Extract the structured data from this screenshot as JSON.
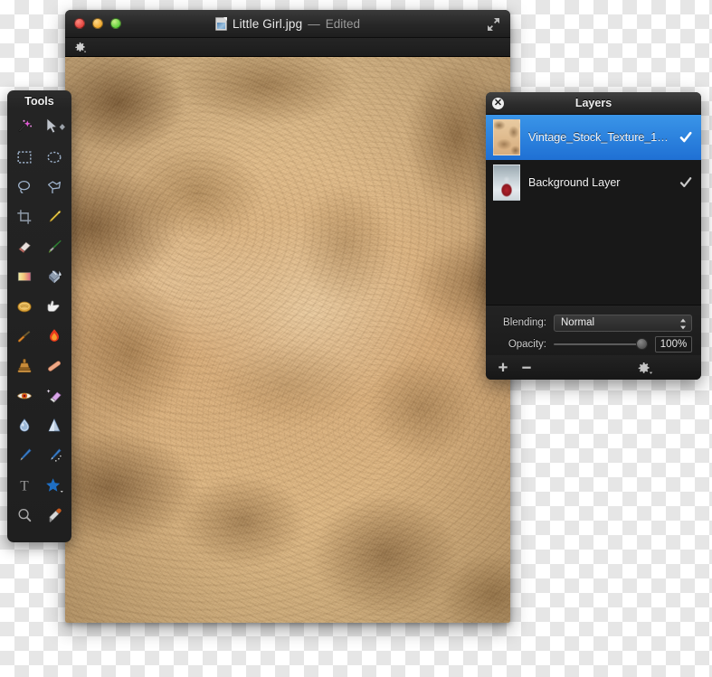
{
  "window": {
    "title_filename": "Little Girl.jpg",
    "title_separator": "—",
    "title_status": "Edited",
    "traffic_lights": [
      "close",
      "minimize",
      "zoom"
    ],
    "fullscreen_icon": "fullscreen-arrows-icon",
    "doc_icon": "jpeg-document-icon",
    "toolstrip_gear_icon": "gear-dropdown-icon"
  },
  "tools": {
    "title": "Tools",
    "items": [
      {
        "name": "magic-wand-tool",
        "icon": "magic-wand-icon"
      },
      {
        "name": "move-tool",
        "icon": "arrow-move-icon"
      },
      {
        "name": "rectangular-select-tool",
        "icon": "rectangle-marquee-icon"
      },
      {
        "name": "elliptical-select-tool",
        "icon": "ellipse-marquee-icon"
      },
      {
        "name": "lasso-tool",
        "icon": "lasso-icon"
      },
      {
        "name": "polygon-lasso-tool",
        "icon": "polygon-lasso-icon"
      },
      {
        "name": "crop-tool",
        "icon": "crop-icon"
      },
      {
        "name": "pencil-tool",
        "icon": "pencil-icon"
      },
      {
        "name": "eraser-tool",
        "icon": "eraser-icon"
      },
      {
        "name": "paintbrush-tool",
        "icon": "paintbrush-icon"
      },
      {
        "name": "gradient-tool",
        "icon": "gradient-icon"
      },
      {
        "name": "paint-bucket-tool",
        "icon": "paint-bucket-icon"
      },
      {
        "name": "clone-tool",
        "icon": "stamp-disc-icon"
      },
      {
        "name": "smudge-tool",
        "icon": "smudge-hand-icon"
      },
      {
        "name": "blur-brush-tool",
        "icon": "wide-brush-icon"
      },
      {
        "name": "burn-tool",
        "icon": "flame-icon"
      },
      {
        "name": "rubber-stamp-tool",
        "icon": "rubber-stamp-icon"
      },
      {
        "name": "bandage-tool",
        "icon": "bandage-icon"
      },
      {
        "name": "red-eye-tool",
        "icon": "eye-icon"
      },
      {
        "name": "background-eraser-tool",
        "icon": "magic-eraser-icon"
      },
      {
        "name": "water-drop-tool",
        "icon": "water-drop-icon"
      },
      {
        "name": "sharpen-cone-tool",
        "icon": "cone-icon"
      },
      {
        "name": "draw-pen-tool",
        "icon": "blue-pencil-icon"
      },
      {
        "name": "vector-pen-tool",
        "icon": "vector-pen-icon"
      },
      {
        "name": "text-tool",
        "icon": "text-t-icon"
      },
      {
        "name": "shape-tool",
        "icon": "star-shape-icon"
      },
      {
        "name": "zoom-tool",
        "icon": "magnifier-icon"
      },
      {
        "name": "eyedropper-tool",
        "icon": "eyedropper-icon"
      }
    ]
  },
  "layers_panel": {
    "title": "Layers",
    "close_icon": "close-x-icon",
    "layers": [
      {
        "name": "Vintage_Stock_Texture_1_b...",
        "visible_checked": true,
        "selected": true,
        "thumbnail": "vintage-paper-texture-thumbnail"
      },
      {
        "name": "Background Layer",
        "visible_checked": true,
        "selected": false,
        "thumbnail": "snowy-photo-thumbnail"
      }
    ],
    "blending": {
      "label": "Blending:",
      "value": "Normal",
      "stepper_icon": "stepper-up-down-icon"
    },
    "opacity": {
      "label": "Opacity:",
      "value": "100%",
      "slider_percent": 100
    },
    "footer": {
      "add_icon": "plus-icon",
      "remove_icon": "minus-icon",
      "gear_icon": "gear-dropdown-icon"
    }
  },
  "colors": {
    "selection_blue": "#2f86e0",
    "panel_dark": "#1d1d1d",
    "titlebar_dark": "#2b2b2b",
    "paper_base": "#ddb886",
    "paper_dark_mottle": "#5a3a16",
    "text_light": "#f0f0f0"
  }
}
